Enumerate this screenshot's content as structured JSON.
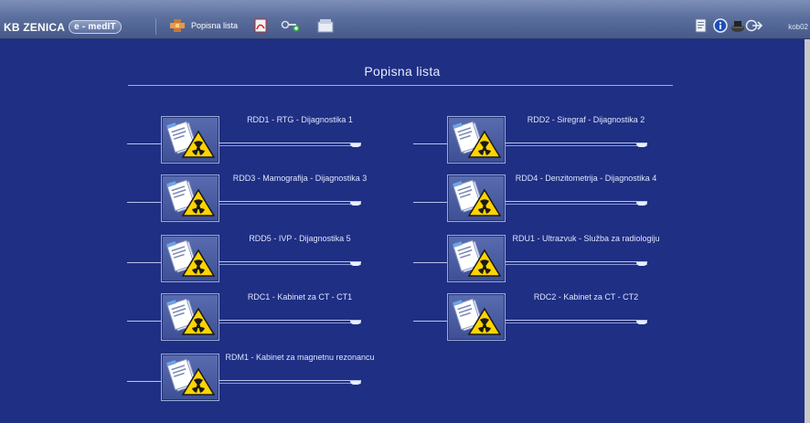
{
  "toolbar": {
    "brand": "KB ZENICA",
    "brand_sub": "e - medIT",
    "current_label": "Popisna lista",
    "user_name": "kob02"
  },
  "main": {
    "title": "Popisna lista",
    "tiles": [
      {
        "label": "RDD1 - RTG - Dijagnostika 1"
      },
      {
        "label": "RDD2 - Siregraf - Dijagnostika 2"
      },
      {
        "label": "RDD3 - Mamografija - Dijagnostika 3"
      },
      {
        "label": "RDD4 - Denzitometrija - Dijagnostika 4"
      },
      {
        "label": "RDD5 - IVP - Dijagnostika 5"
      },
      {
        "label": "RDU1 - Ultrazvuk - Služba za radiologiju"
      },
      {
        "label": "RDC1 - Kabinet za CT - CT1"
      },
      {
        "label": "RDC2 - Kabinet za CT - CT2"
      },
      {
        "label": "RDM1 - Kabinet za magnetnu rezonancu"
      }
    ]
  },
  "colors": {
    "background": "#1f2f83",
    "toolbar": "#5b6f9d",
    "text": "#dde4ff"
  },
  "icons": {
    "tile": "radiology-document-icon",
    "toolbar": [
      "module-icon",
      "pdf-icon",
      "key-icon",
      "folder-icon",
      "report-icon",
      "info-icon",
      "user-icon",
      "logout-icon"
    ]
  }
}
